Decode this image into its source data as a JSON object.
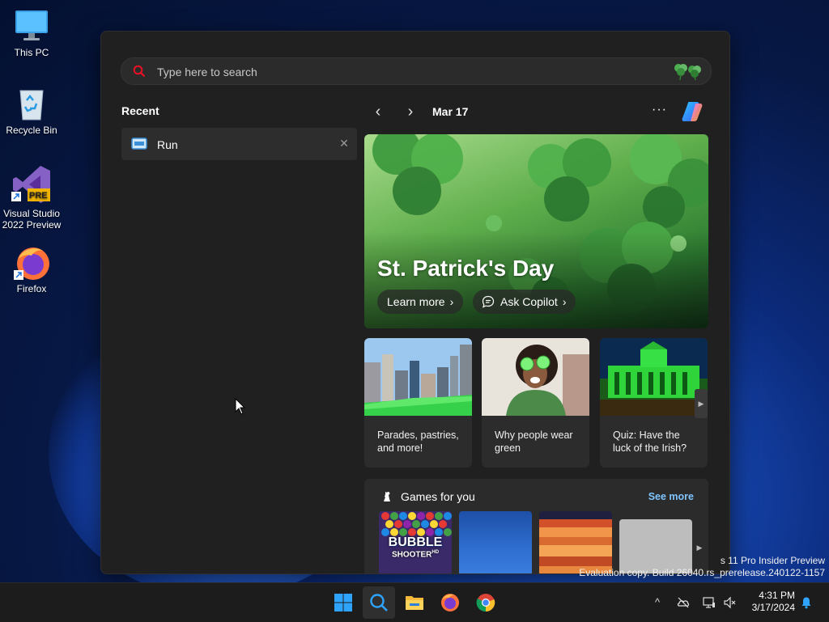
{
  "desktop": {
    "icons": [
      {
        "label": "This PC"
      },
      {
        "label": "Recycle Bin"
      },
      {
        "label": "Visual Studio 2022 Preview",
        "badge": "PRE"
      },
      {
        "label": "Firefox"
      }
    ]
  },
  "search": {
    "placeholder": "Type here to search"
  },
  "recent": {
    "title": "Recent",
    "items": [
      {
        "label": "Run",
        "close": "✕"
      }
    ]
  },
  "feed": {
    "prev": "‹",
    "next": "›",
    "date": "Mar 17",
    "more": "···",
    "hero": {
      "title": "St. Patrick's Day",
      "learn_more": "Learn more",
      "ask_copilot": "Ask Copilot",
      "chevron": "›"
    },
    "cards": [
      {
        "caption": "Parades, pastries, and more!"
      },
      {
        "caption": "Why people wear green"
      },
      {
        "caption": "Quiz: Have the luck of the Irish?"
      }
    ],
    "card_arrow": "▶",
    "games": {
      "title": "Games for you",
      "see_more": "See more",
      "tile1_text": "BUBBLE",
      "tile1_sub": "SHOOTER",
      "tile1_hd": "HD",
      "arrow": "▶"
    }
  },
  "watermark": {
    "line1": "s 11 Pro Insider Preview",
    "line2": "Evaluation copy. Build 26040.rs_prerelease.240122-1157"
  },
  "taskbar": {
    "time": "4:31 PM",
    "date": "3/17/2024",
    "tray_chevron": "^"
  },
  "colors": {
    "accent_blue": "#7fc4ff",
    "panel_bg": "#202020",
    "search_icon_red": "#e81123"
  }
}
